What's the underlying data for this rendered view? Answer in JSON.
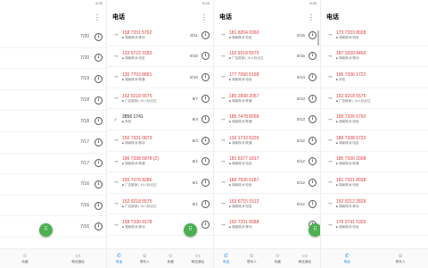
{
  "panels": [
    {
      "status": {
        "time": "",
        "right": "5:20"
      },
      "title": "",
      "rows": [
        {
          "date": "7/20"
        },
        {
          "date": "7/20"
        },
        {
          "date": "7/19"
        },
        {
          "date": "7/18"
        },
        {
          "date": "7/18"
        },
        {
          "date": "7/17"
        },
        {
          "date": "7/17"
        },
        {
          "date": "7/16"
        },
        {
          "date": "7/16"
        },
        {
          "date": "7/16"
        }
      ],
      "tabs": [
        {
          "icon": "☆",
          "label": "收藏"
        },
        {
          "icon": "▭",
          "label": "畅连通话"
        }
      ]
    },
    {
      "status": {
        "time": "",
        "right": "5:20"
      },
      "title": "电话",
      "rows": [
        {
          "number": "158 7331 5762",
          "color": "red",
          "sub": "湖南株洲 移动",
          "date": "8/11"
        },
        {
          "number": "133 5722 3183",
          "color": "red",
          "sub": "湖南株洲 电信",
          "date": "8/10"
        },
        {
          "number": "130 7703 8891",
          "color": "red",
          "sub": "湖南株洲 联通",
          "date": "8/10"
        },
        {
          "number": "152 9218 5575",
          "color": "red",
          "sub": "广告推销 | 15人标记过",
          "date": "8/7"
        },
        {
          "number": "2856 1741",
          "color": "dark",
          "sub": "未知",
          "date": "8/4"
        },
        {
          "number": "150 7331 0873",
          "color": "red",
          "sub": "湖南株洲 移动",
          "date": "8/2"
        },
        {
          "number": "186 7338 5878 (2)",
          "color": "red",
          "sub": "湖南株洲 联通",
          "date": "8/1"
        },
        {
          "number": "155 7076 8286",
          "color": "red",
          "sub": "广告推销 | 15人标记过",
          "date": "8/1"
        },
        {
          "number": "152 9218 5575",
          "color": "red",
          "sub": "广告推销 | 15人标记过",
          "date": "8/1"
        },
        {
          "number": "158 7330 9178",
          "color": "red",
          "sub": "湖南株洲 移动",
          "date": ""
        }
      ],
      "tabs": [
        {
          "icon": "✆",
          "label": "电话"
        },
        {
          "icon": "☺",
          "label": "联系人"
        },
        {
          "icon": "☆",
          "label": "收藏"
        },
        {
          "icon": "▭",
          "label": "畅连通话"
        }
      ]
    },
    {
      "status": {
        "time": "",
        "right": "5:20"
      },
      "title": "电话",
      "rows": [
        {
          "number": "181 8204 3360",
          "color": "red",
          "sub": "湖南株洲 电信",
          "date": "8/15"
        },
        {
          "number": "152 9218 5575",
          "color": "red",
          "sub": "广告推销 | 15人标记过",
          "date": "8/15"
        },
        {
          "number": "177 7090 5168",
          "color": "red",
          "sub": "湖南株洲 电信",
          "date": "8/14"
        },
        {
          "number": "185 2838 2057",
          "color": "red",
          "sub": "湖南株洲 联通",
          "date": "8/13"
        },
        {
          "number": "185 7478 8268",
          "color": "red",
          "sub": "湖南株洲 联通",
          "date": "8/13"
        },
        {
          "number": "132 1733 5226",
          "color": "red",
          "sub": "湖南株洲 联通",
          "date": "8/12"
        },
        {
          "number": "181 5377 1817",
          "color": "red",
          "sub": "湖南株洲 电信",
          "date": "8/12"
        },
        {
          "number": "189 7535 6187",
          "color": "red",
          "sub": "湖南株洲 电信",
          "date": "8/12"
        },
        {
          "number": "153 6715 1512",
          "color": "red",
          "sub": "湖南株洲 电信",
          "date": "8/12"
        },
        {
          "number": "152 7331 6588",
          "color": "red",
          "sub": "湖南株洲 移动",
          "date": ""
        }
      ],
      "tabs": [
        {
          "icon": "✆",
          "label": "电话"
        },
        {
          "icon": "☺",
          "label": "联系人"
        },
        {
          "icon": "☆",
          "label": "收藏"
        },
        {
          "icon": "▭",
          "label": "畅连通话"
        }
      ]
    },
    {
      "status": {
        "time": "",
        "right": ""
      },
      "title": "电话",
      "rows": [
        {
          "number": "173 7333 8028",
          "color": "red",
          "sub": "湖南株洲 电信",
          "date": ""
        },
        {
          "number": "187 3339 8493",
          "color": "red",
          "sub": "湖南株洲 移动",
          "date": ""
        },
        {
          "number": "195 7336 1722",
          "color": "red",
          "sub": "未知",
          "date": ""
        },
        {
          "number": "152 9218 5575",
          "color": "red",
          "sub": "广告推销 | 15人标记过",
          "date": ""
        },
        {
          "number": "189 7336 5792",
          "color": "red",
          "sub": "湖南株洲 电信",
          "date": ""
        },
        {
          "number": "189 7338 6732",
          "color": "red",
          "sub": "湖南株洲 电信",
          "date": ""
        },
        {
          "number": "185 7330 2008",
          "color": "red",
          "sub": "湖南株洲 联通",
          "date": ""
        },
        {
          "number": "181 7331 8938",
          "color": "red",
          "sub": "湖南株洲 电信",
          "date": ""
        },
        {
          "number": "152 9212 2828",
          "color": "red",
          "sub": "湖南株洲 移动",
          "date": ""
        },
        {
          "number": "176 0741 5303",
          "color": "red",
          "sub": "湖南株洲 电信",
          "date": ""
        }
      ],
      "tabs": [
        {
          "icon": "✆",
          "label": "电话"
        },
        {
          "icon": "☺",
          "label": "联系人"
        }
      ]
    }
  ],
  "colors": {
    "missed": "#e53935",
    "accent": "#1e88e5",
    "fab": "#4caf50"
  },
  "icons": {
    "info": "i",
    "more": "⋮",
    "dialpad": "⠿",
    "missed_call": "↝",
    "incoming": "↙"
  }
}
